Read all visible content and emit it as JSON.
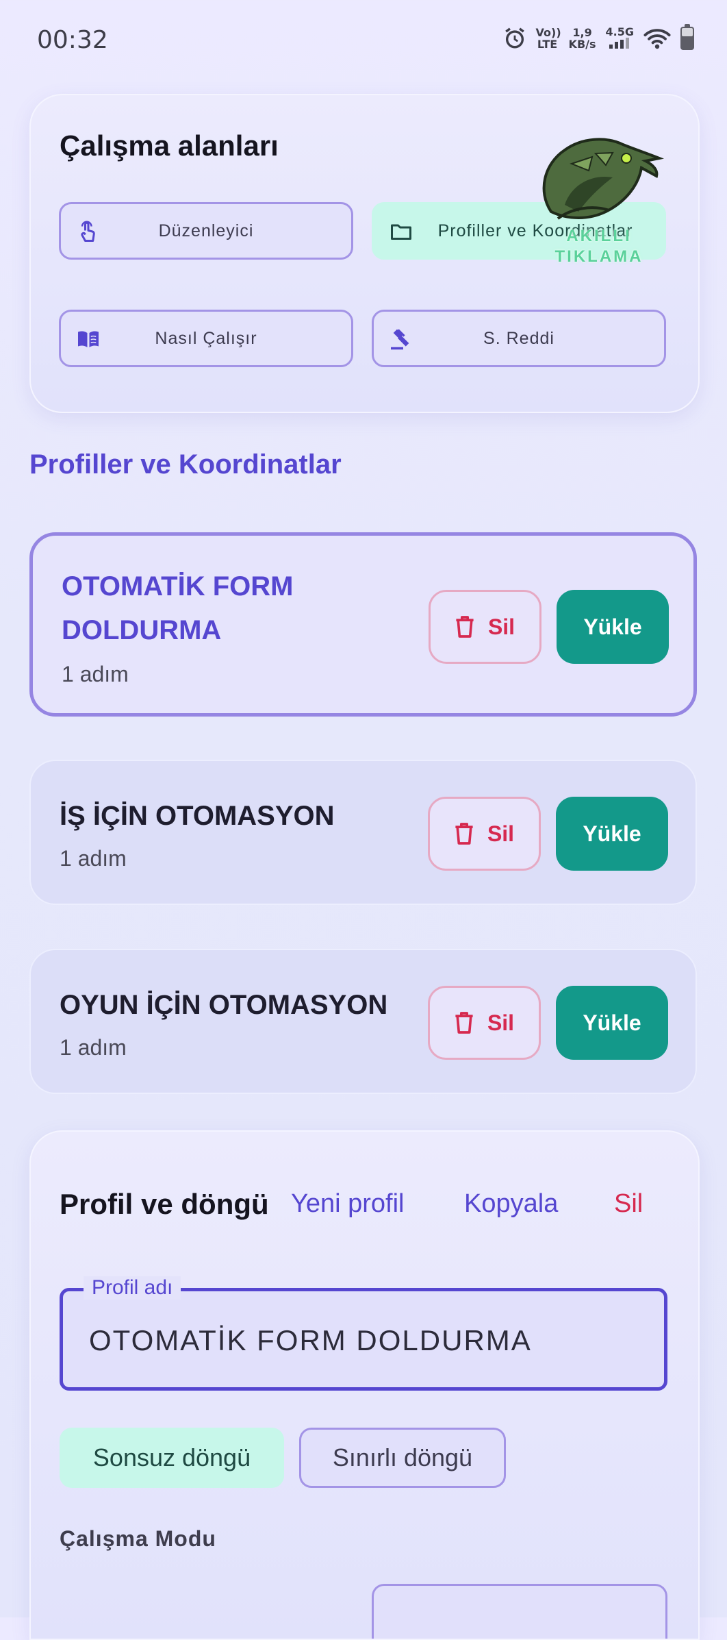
{
  "status_bar": {
    "time": "00:32",
    "network_label": "Vo)) LTE",
    "speed_value": "1,9",
    "speed_unit": "KB/s",
    "signal_label": "4.5G"
  },
  "workspaces": {
    "title": "Çalışma alanları",
    "buttons": [
      {
        "label": "Düzenleyici",
        "icon": "touch-icon",
        "active": false
      },
      {
        "label": "Profiller ve Koordinatlar",
        "icon": "folder-icon",
        "active": true
      },
      {
        "label": "Nasıl Çalışır",
        "icon": "book-icon",
        "active": false
      },
      {
        "label": "S. Reddi",
        "icon": "gavel-icon",
        "active": false
      }
    ],
    "logo_text_1": "AKILLI",
    "logo_text_2": "TIKLAMA"
  },
  "section_title": "Profiller ve Koordinatlar",
  "profiles": [
    {
      "name": "OTOMATİK FORM DOLDURMA",
      "steps": "1 adım",
      "selected": true,
      "delete_label": "Sil",
      "load_label": "Yükle"
    },
    {
      "name": "İŞ İÇİN OTOMASYON",
      "steps": "1 adım",
      "selected": false,
      "delete_label": "Sil",
      "load_label": "Yükle"
    },
    {
      "name": "OYUN İÇİN OTOMASYON",
      "steps": "1 adım",
      "selected": false,
      "delete_label": "Sil",
      "load_label": "Yükle"
    }
  ],
  "profile_loop": {
    "title": "Profil ve döngü",
    "new_label": "Yeni profil",
    "copy_label": "Kopyala",
    "delete_label": "Sil",
    "field_label": "Profil adı",
    "field_value": "OTOMATİK FORM DOLDURMA",
    "infinite_label": "Sonsuz döngü",
    "limited_label": "Sınırlı döngü",
    "mode_label": "Çalışma Modu"
  },
  "colors": {
    "accent": "#5546d0",
    "primary_button": "#13998a",
    "danger": "#d6294f",
    "active_chip": "#c7f7ea"
  }
}
